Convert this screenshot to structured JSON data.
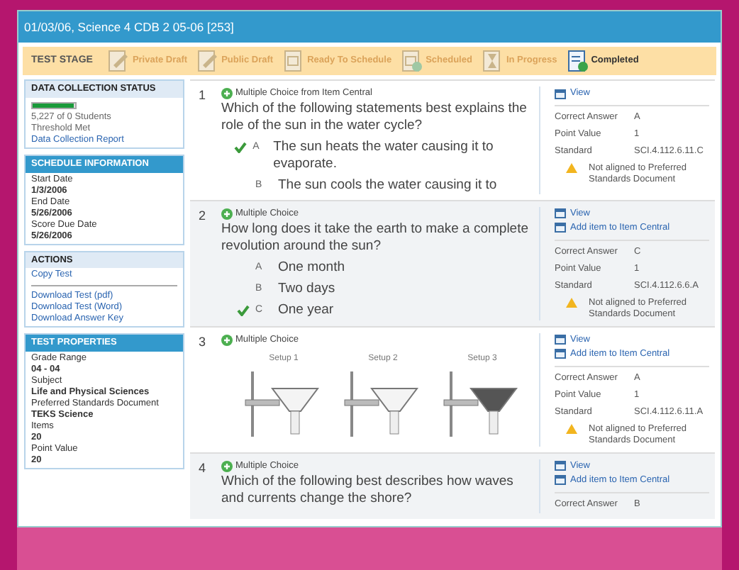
{
  "window": {
    "title": "01/03/06, Science 4 CDB 2 05-06 [253]"
  },
  "stage_bar": {
    "label": "TEST STAGE",
    "stages": [
      {
        "label": "Private Draft",
        "kind": "draft",
        "selected": false
      },
      {
        "label": "Public Draft",
        "kind": "draft",
        "selected": false
      },
      {
        "label": "Ready To Schedule",
        "kind": "calendar",
        "selected": false
      },
      {
        "label": "Scheduled",
        "kind": "calendar-check",
        "selected": false
      },
      {
        "label": "In Progress",
        "kind": "hourglass",
        "selected": false
      },
      {
        "label": "Completed",
        "kind": "doc-check",
        "selected": true
      }
    ]
  },
  "sidebar": {
    "data_collection": {
      "title": "DATA COLLECTION STATUS",
      "level": 0.95,
      "students": "5,227 of 0 Students",
      "threshold": "Threshold Met",
      "link": "Data Collection Report"
    },
    "schedule": {
      "title": "SCHEDULE INFORMATION",
      "fields": [
        {
          "label": "Start Date",
          "value": "1/3/2006"
        },
        {
          "label": "End Date",
          "value": "5/26/2006"
        },
        {
          "label": "Score Due Date",
          "value": "5/26/2006"
        }
      ]
    },
    "actions": {
      "title": "ACTIONS",
      "primary": [
        "Copy Test"
      ],
      "downloads": [
        "Download Test (pdf)",
        "Download Test (Word)",
        "Download Answer Key"
      ]
    },
    "properties": {
      "title": "TEST PROPERTIES",
      "fields": [
        {
          "label": "Grade Range",
          "value": "04 - 04"
        },
        {
          "label": "Subject",
          "value": "Life and Physical Sciences"
        },
        {
          "label": "Preferred Standards Document",
          "value": "TEKS Science"
        },
        {
          "label": "Items",
          "value": "20"
        },
        {
          "label": "Point Value",
          "value": "20"
        }
      ]
    }
  },
  "questions": [
    {
      "number": "1",
      "type": "Multiple Choice from Item Central",
      "text": "Which of the following statements best explains the role of the sun in the water cycle?",
      "choices": [
        {
          "letter": "A",
          "text": "The sun heats the water causing it to evaporate.",
          "correct": true
        },
        {
          "letter": "B",
          "text": "The sun cools the water causing it to",
          "correct": false
        }
      ],
      "links": [
        "View"
      ],
      "details": [
        {
          "label": "Correct Answer",
          "value": "A"
        },
        {
          "label": "Point Value",
          "value": "1"
        },
        {
          "label": "Standard",
          "value": "SCI.4.112.6.11.C"
        }
      ],
      "warning": "Not aligned to Preferred Standards Document"
    },
    {
      "number": "2",
      "type": "Multiple Choice",
      "text": "How long does it take the earth to make a complete revolution around the sun?",
      "choices": [
        {
          "letter": "A",
          "text": "One month",
          "correct": false
        },
        {
          "letter": "B",
          "text": "Two days",
          "correct": false
        },
        {
          "letter": "C",
          "text": "One year",
          "correct": true
        }
      ],
      "links": [
        "View",
        "Add item to Item Central"
      ],
      "details": [
        {
          "label": "Correct Answer",
          "value": "C"
        },
        {
          "label": "Point Value",
          "value": "1"
        },
        {
          "label": "Standard",
          "value": "SCI.4.112.6.6.A"
        }
      ],
      "warning": "Not aligned to Preferred Standards Document"
    },
    {
      "number": "3",
      "type": "Multiple Choice",
      "figures": [
        {
          "label": "Setup 1",
          "filled": false
        },
        {
          "label": "Setup 2",
          "filled": false
        },
        {
          "label": "Setup 3",
          "filled": true
        }
      ],
      "links": [
        "View",
        "Add item to Item Central"
      ],
      "details": [
        {
          "label": "Correct Answer",
          "value": "A"
        },
        {
          "label": "Point Value",
          "value": "1"
        },
        {
          "label": "Standard",
          "value": "SCI.4.112.6.11.A"
        }
      ],
      "warning": "Not aligned to Preferred Standards Document"
    },
    {
      "number": "4",
      "type": "Multiple Choice",
      "text": "Which of the following best describes how waves and currents change the shore?",
      "links": [
        "View",
        "Add item to Item Central"
      ],
      "details": [
        {
          "label": "Correct Answer",
          "value": "B"
        }
      ]
    }
  ]
}
